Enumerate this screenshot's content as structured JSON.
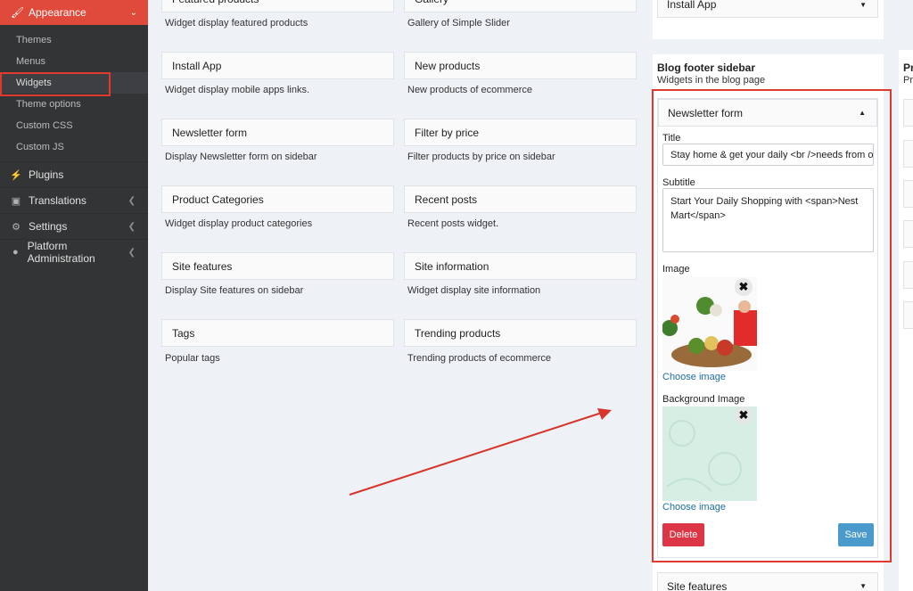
{
  "sidebar": {
    "active": {
      "label": "Appearance",
      "icon": "brush-icon"
    },
    "subitems": [
      "Themes",
      "Menus",
      "Widgets",
      "Theme options",
      "Custom CSS",
      "Custom JS"
    ],
    "items": [
      {
        "label": "Plugins",
        "icon": "plug-icon"
      },
      {
        "label": "Translations",
        "icon": "translate-icon"
      },
      {
        "label": "Settings",
        "icon": "gears-icon"
      },
      {
        "label": "Platform Administration",
        "icon": "user-gear-icon"
      }
    ]
  },
  "widgets": [
    {
      "title": "Featured products",
      "desc": "Widget display featured products"
    },
    {
      "title": "Gallery",
      "desc": "Gallery of Simple Slider"
    },
    {
      "title": "Install App",
      "desc": "Widget display mobile apps links."
    },
    {
      "title": "New products",
      "desc": "New products of ecommerce"
    },
    {
      "title": "Newsletter form",
      "desc": "Display Newsletter form on sidebar"
    },
    {
      "title": "Filter by price",
      "desc": "Filter products by price on sidebar"
    },
    {
      "title": "Product Categories",
      "desc": "Widget display product categories"
    },
    {
      "title": "Recent posts",
      "desc": "Recent posts widget."
    },
    {
      "title": "Site features",
      "desc": "Display Site features on sidebar"
    },
    {
      "title": "Site information",
      "desc": "Widget display site information"
    },
    {
      "title": "Tags",
      "desc": "Popular tags"
    },
    {
      "title": "Trending products",
      "desc": "Trending products of ecommerce"
    }
  ],
  "right": {
    "top_widget": "Install App",
    "section_title": "Blog footer sidebar",
    "section_sub": "Widgets in the blog page",
    "panel": {
      "header": "Newsletter form",
      "title_label": "Title",
      "title_value": "Stay home & get your daily <br />needs from our",
      "subtitle_label": "Subtitle",
      "subtitle_value": "Start Your Daily Shopping with <span>Nest Mart</span>",
      "image_label": "Image",
      "bg_image_label": "Background Image",
      "choose_image": "Choose image",
      "delete": "Delete",
      "save": "Save"
    },
    "bottom_widget": "Site features",
    "far_right_title": "Pr",
    "far_right_sub": "Pri"
  },
  "colors": {
    "accent": "#e04a3a",
    "delete": "#dc3545",
    "save": "#4a9acb",
    "link": "#1d6fa5"
  }
}
